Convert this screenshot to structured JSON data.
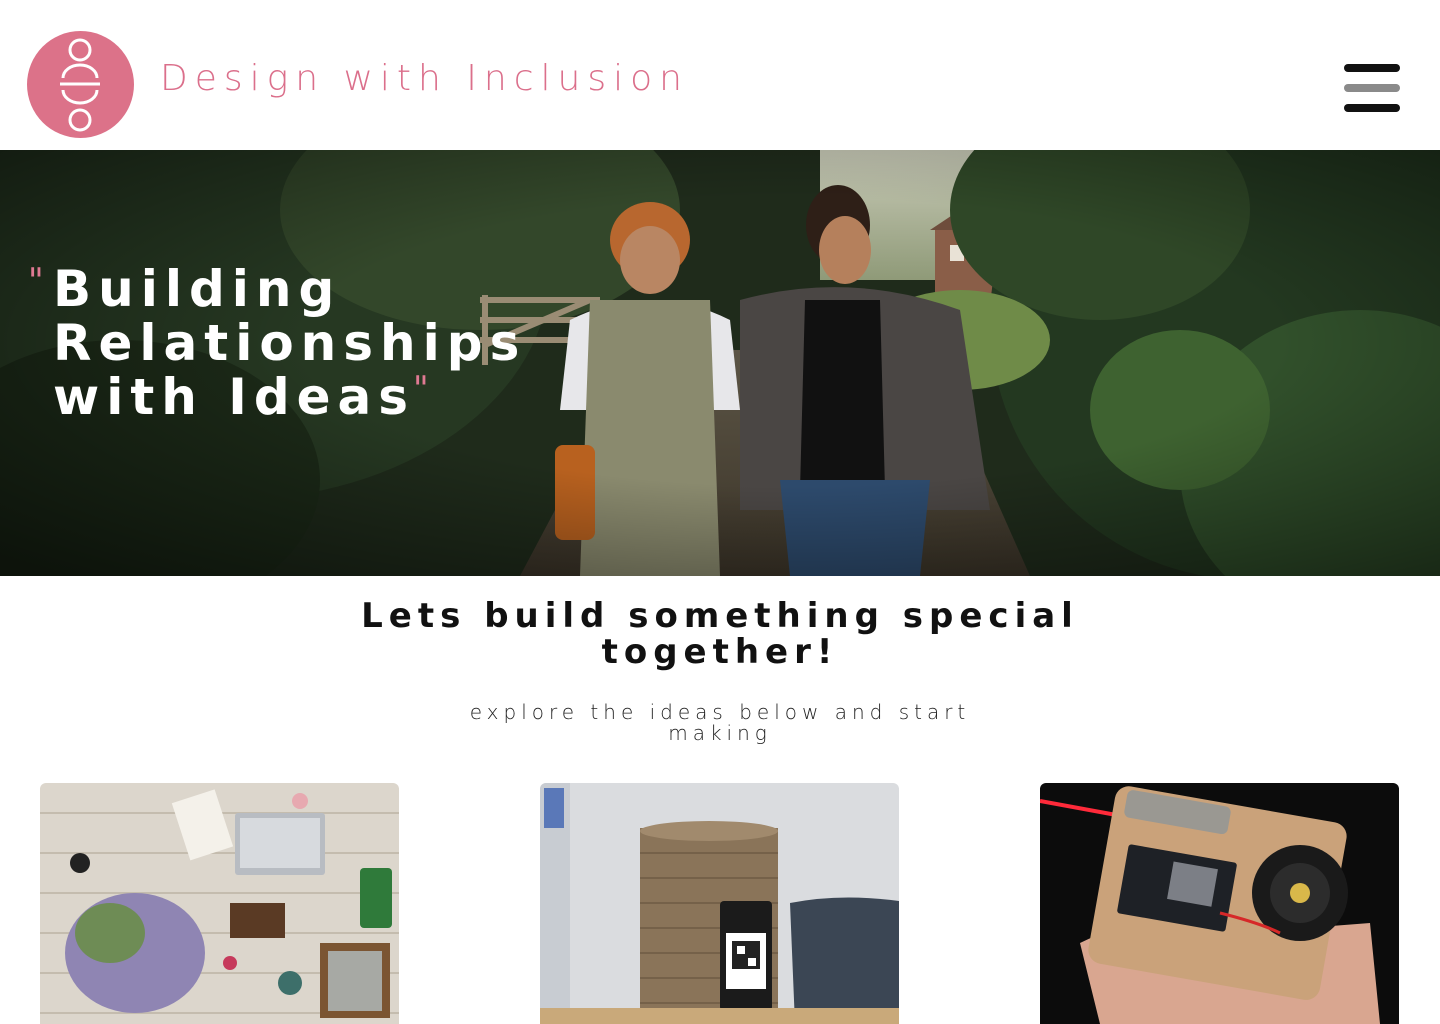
{
  "header": {
    "brand_name": "Design with Inclusion",
    "logo_color": "#dc7289",
    "menu_icon": "hamburger-icon"
  },
  "hero": {
    "quote_lines": [
      "Building",
      "Relationships",
      "with Ideas"
    ],
    "open_quote": "\"",
    "close_quote": "\"",
    "accent_color": "#e07a93",
    "image_description_icon": "photo-two-women-walking"
  },
  "intro": {
    "title": "Lets build something special together!",
    "subtitle": "explore the ideas below and start making"
  },
  "cards": [
    {
      "image_icon": "craft-table-photo"
    },
    {
      "image_icon": "cardboard-cylinder-photo"
    },
    {
      "image_icon": "laser-circuit-board-photo"
    }
  ]
}
